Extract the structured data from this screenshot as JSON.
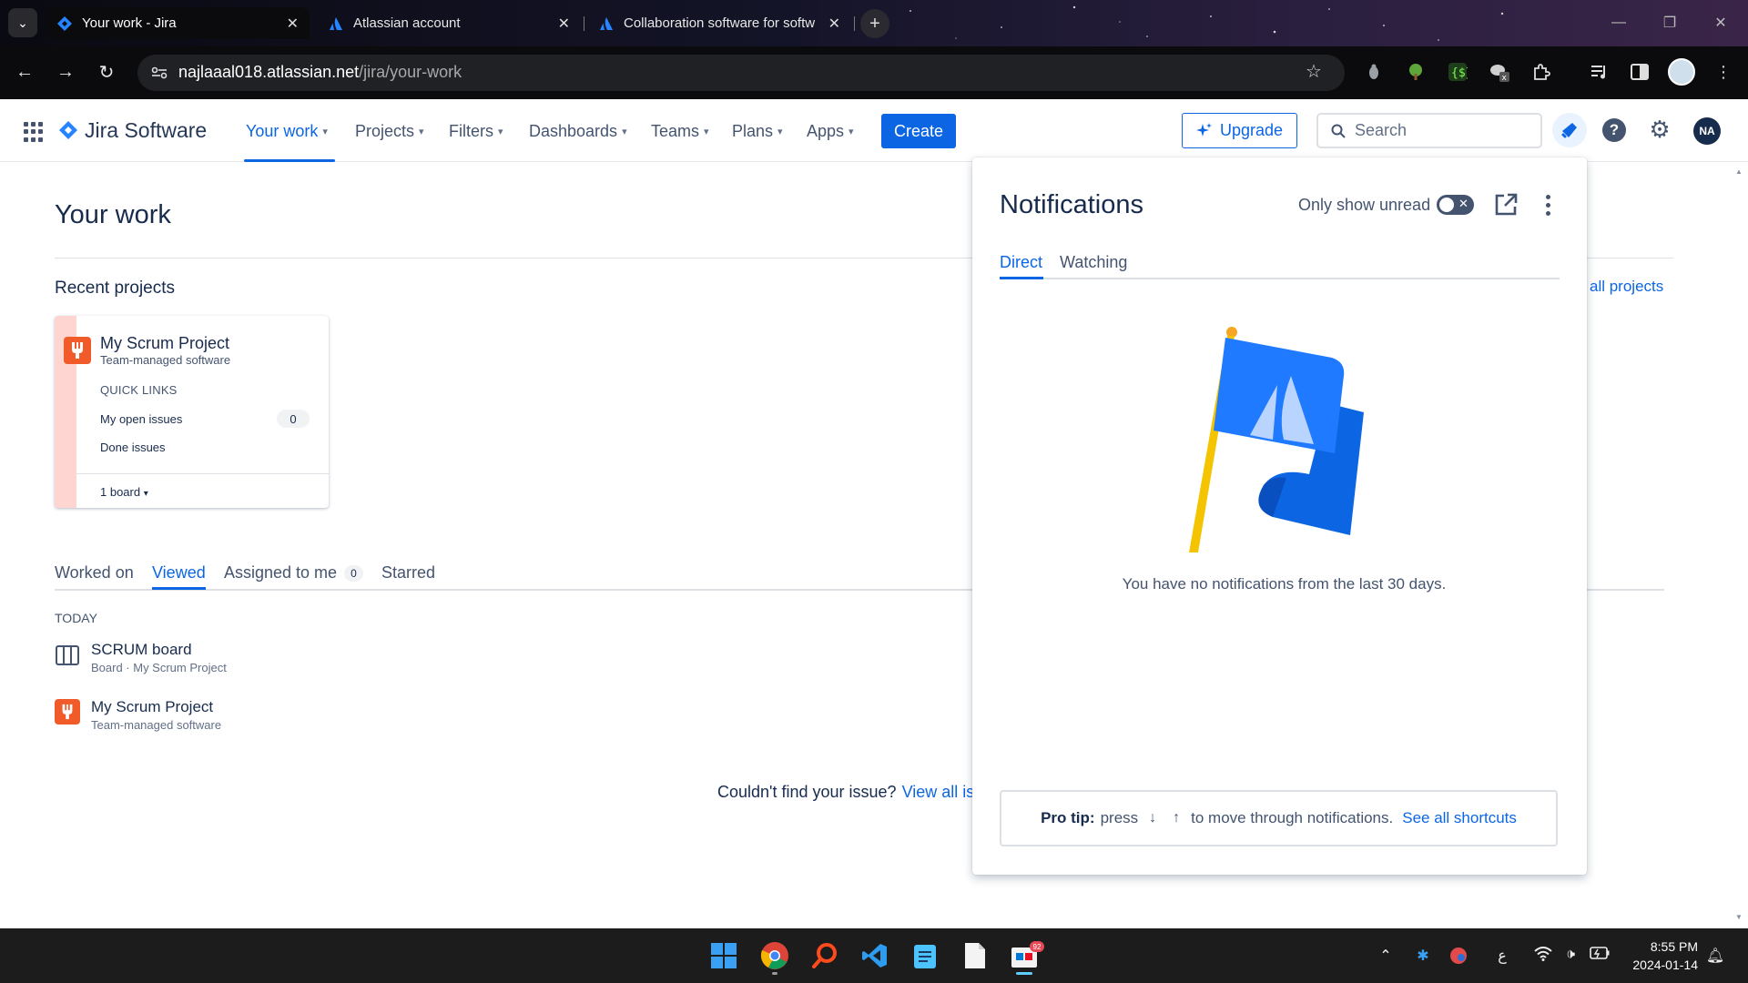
{
  "browser": {
    "tabs": [
      {
        "title": "Your work - Jira",
        "active": true
      },
      {
        "title": "Atlassian account",
        "active": false
      },
      {
        "title": "Collaboration software for softw",
        "active": false
      }
    ],
    "url_host": "najlaaal018.atlassian.net",
    "url_path": "/jira/your-work"
  },
  "jira_nav": {
    "brand": "Jira Software",
    "items": [
      "Your work",
      "Projects",
      "Filters",
      "Dashboards",
      "Teams",
      "Plans",
      "Apps"
    ],
    "create_label": "Create",
    "upgrade_label": "Upgrade",
    "search_placeholder": "Search",
    "avatar_initials": "NA"
  },
  "main": {
    "title": "Your work",
    "recent_projects_heading": "Recent projects",
    "view_all_projects": "all projects",
    "project_card": {
      "name": "My Scrum Project",
      "type": "Team-managed software",
      "quick_links_heading": "QUICK LINKS",
      "links": [
        {
          "label": "My open issues",
          "count": "0"
        },
        {
          "label": "Done issues"
        }
      ],
      "board_label": "1 board"
    },
    "tabs": [
      {
        "label": "Worked on"
      },
      {
        "label": "Viewed",
        "active": true
      },
      {
        "label": "Assigned to me",
        "count": "0"
      },
      {
        "label": "Starred"
      }
    ],
    "today_label": "TODAY",
    "recent_items": [
      {
        "title": "SCRUM board",
        "subtitle": "Board · My Scrum Project",
        "icon": "board-icon"
      },
      {
        "title": "My Scrum Project",
        "subtitle": "Team-managed software",
        "icon": "project-icon"
      }
    ],
    "not_found_text": "Couldn't find your issue?",
    "not_found_link": "View all iss"
  },
  "notifications": {
    "title": "Notifications",
    "unread_label": "Only show unread",
    "tabs": [
      "Direct",
      "Watching"
    ],
    "empty_message": "You have no notifications from the last 30 days.",
    "tip_bold": "Pro tip:",
    "tip_press": "press",
    "tip_text": "to move through notifications.",
    "tip_link": "See all shortcuts"
  },
  "taskbar": {
    "time": "8:55 PM",
    "date": "2024-01-14",
    "language": "ع",
    "badge": "92"
  },
  "colors": {
    "accent": "#0c66e4",
    "project_icon": "#f15b2a",
    "text": "#172b4d"
  }
}
